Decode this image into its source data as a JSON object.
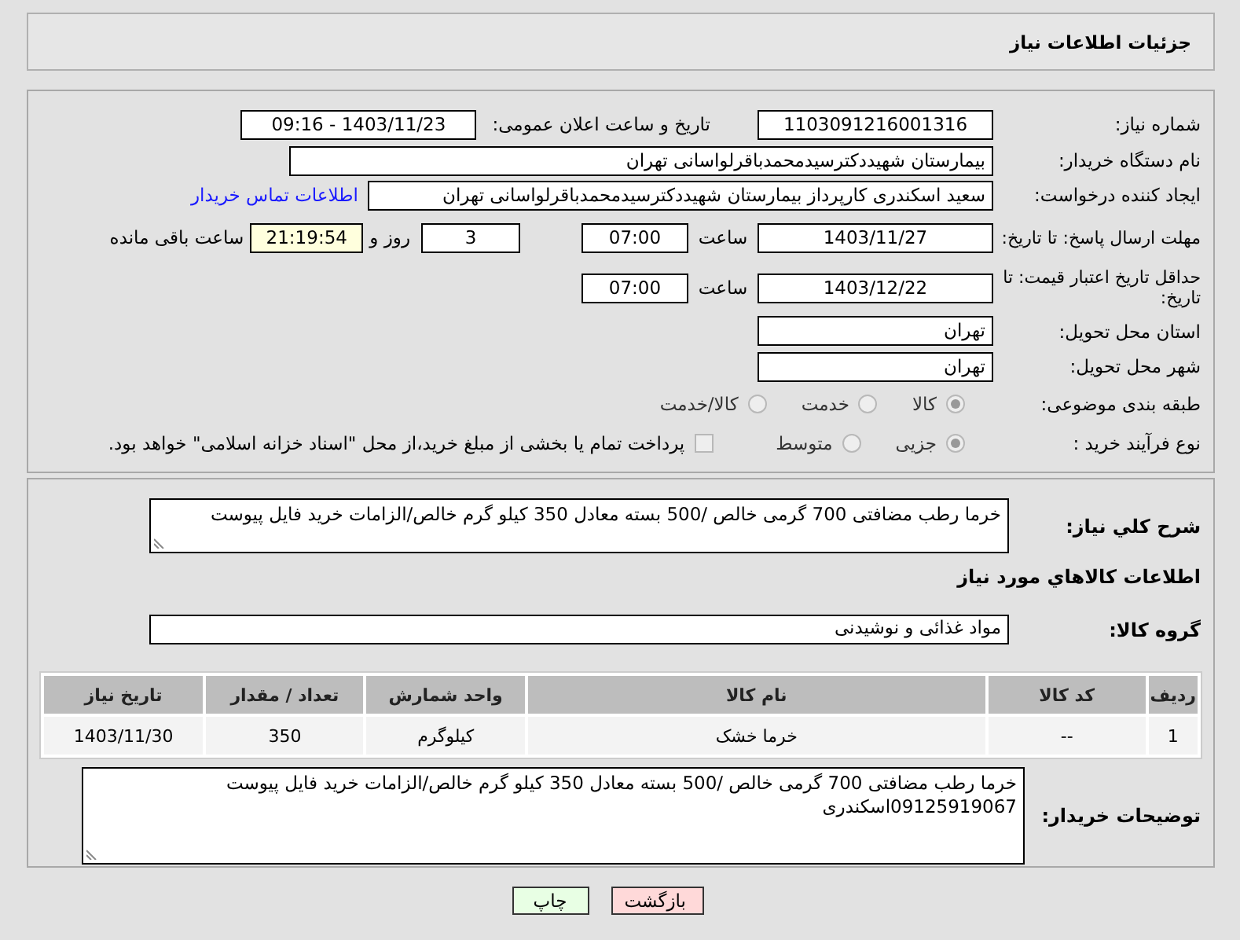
{
  "header": {
    "title": "جزئیات اطلاعات نیاز"
  },
  "details": {
    "need_number": {
      "label": "شماره نیاز:",
      "value": "1103091216001316"
    },
    "announce": {
      "label": "تاریخ و ساعت اعلان عمومی:",
      "value": "1403/11/23 - 09:16"
    },
    "buyer_org": {
      "label": "نام دستگاه خریدار:",
      "value": "بیمارستان شهیددکترسیدمحمدباقرلواسانی تهران"
    },
    "requester": {
      "label": "ایجاد کننده درخواست:",
      "value": "سعید اسکندری کارپرداز بیمارستان شهیددکترسیدمحمدباقرلواسانی تهران",
      "link": "اطلاعات تماس خریدار"
    },
    "reply_deadline": {
      "label": "مهلت ارسال پاسخ: تا تاریخ:",
      "date": "1403/11/27",
      "time_label": "ساعت",
      "time": "07:00",
      "days": "3",
      "days_label": "روز و",
      "remaining": "21:19:54",
      "remaining_label": "ساعت باقی مانده"
    },
    "price_validity": {
      "label": "حداقل تاریخ اعتبار قیمت: تا تاریخ:",
      "date": "1403/12/22",
      "time_label": "ساعت",
      "time": "07:00"
    },
    "province": {
      "label": "استان محل تحویل:",
      "value": "تهران"
    },
    "city": {
      "label": "شهر محل تحویل:",
      "value": "تهران"
    },
    "category": {
      "label": "طبقه بندی موضوعی:",
      "options": [
        {
          "label": "کالا",
          "selected": true
        },
        {
          "label": "خدمت",
          "selected": false
        },
        {
          "label": "کالا/خدمت",
          "selected": false
        }
      ]
    },
    "purchase_type": {
      "label": "نوع فرآیند خرید :",
      "options": [
        {
          "label": "جزیی",
          "selected": true
        },
        {
          "label": "متوسط",
          "selected": false
        }
      ],
      "payment_option": {
        "label": "پرداخت تمام یا بخشی از مبلغ خرید،از محل \"اسناد خزانه اسلامی\" خواهد بود.",
        "checked": false
      }
    }
  },
  "summary": {
    "label": "شرح کلي نیاز:",
    "value": "خرما رطب مضافتی 700 گرمی خالص /500 بسته معادل 350 کیلو گرم خالص/الزامات خرید فایل پیوست"
  },
  "goods_heading": "اطلاعات کالاهاي مورد نیاز",
  "goods_group": {
    "label": "گروه کالا:",
    "value": "مواد غذائی و نوشیدنی"
  },
  "table": {
    "columns": [
      "ردیف",
      "کد کالا",
      "نام کالا",
      "واحد شمارش",
      "تعداد / مقدار",
      "تاریخ نیاز"
    ],
    "rows": [
      [
        "1",
        "--",
        "خرما خشک",
        "کیلوگرم",
        "350",
        "1403/11/30"
      ]
    ]
  },
  "buyer_notes": {
    "label": "توضیحات خریدار:",
    "value": "خرما رطب مضافتی 700 گرمی خالص /500 بسته معادل 350 کیلو گرم خالص/الزامات خرید فایل پیوست\n09125919067اسکندری"
  },
  "buttons": [
    {
      "label": "بازگشت",
      "kind": "back"
    },
    {
      "label": "چاپ",
      "kind": "print"
    }
  ]
}
